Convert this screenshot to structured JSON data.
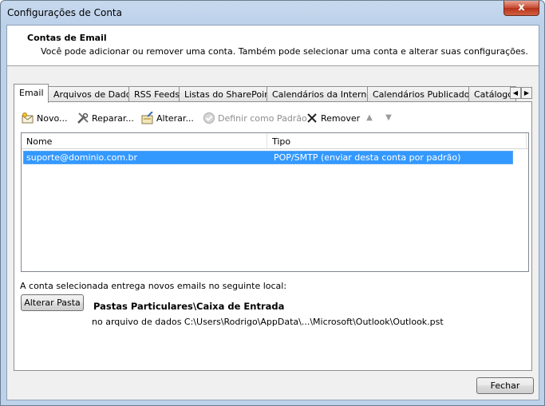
{
  "window": {
    "title": "Configurações de Conta",
    "close_glyph": "x"
  },
  "header": {
    "title": "Contas de Email",
    "description": "Você pode adicionar ou remover uma conta. Também pode selecionar uma conta e alterar suas configurações."
  },
  "tabs": [
    {
      "label": "Email",
      "active": true
    },
    {
      "label": "Arquivos de Dados",
      "active": false
    },
    {
      "label": "RSS Feeds",
      "active": false
    },
    {
      "label": "Listas do SharePoint",
      "active": false
    },
    {
      "label": "Calendários da Internet",
      "active": false
    },
    {
      "label": "Calendários Publicados",
      "active": false
    },
    {
      "label": "Catálogos",
      "active": false
    }
  ],
  "toolbar": {
    "new_label": "Novo...",
    "repair_label": "Reparar...",
    "change_label": "Alterar...",
    "set_default_label": "Definir como Padrão",
    "remove_label": "Remover"
  },
  "accounts_list": {
    "columns": [
      "Nome",
      "Tipo"
    ],
    "rows": [
      {
        "name": "suporte@dominio.com.br",
        "type": "POP/SMTP (enviar desta conta por padrão)",
        "selected": true
      }
    ]
  },
  "delivery": {
    "label": "A conta selecionada entrega novos emails no seguinte local:",
    "change_folder_button": "Alterar Pasta",
    "folder_path": "Pastas Particulares\\Caixa de Entrada",
    "data_file": "no arquivo de dados C:\\Users\\Rodrigo\\AppData\\...\\Microsoft\\Outlook\\Outlook.pst"
  },
  "footer": {
    "close_button": "Fechar"
  },
  "colors": {
    "selection": "#3399ff",
    "titlebar": "#c7d9ee",
    "close_button": "#c6482f"
  }
}
